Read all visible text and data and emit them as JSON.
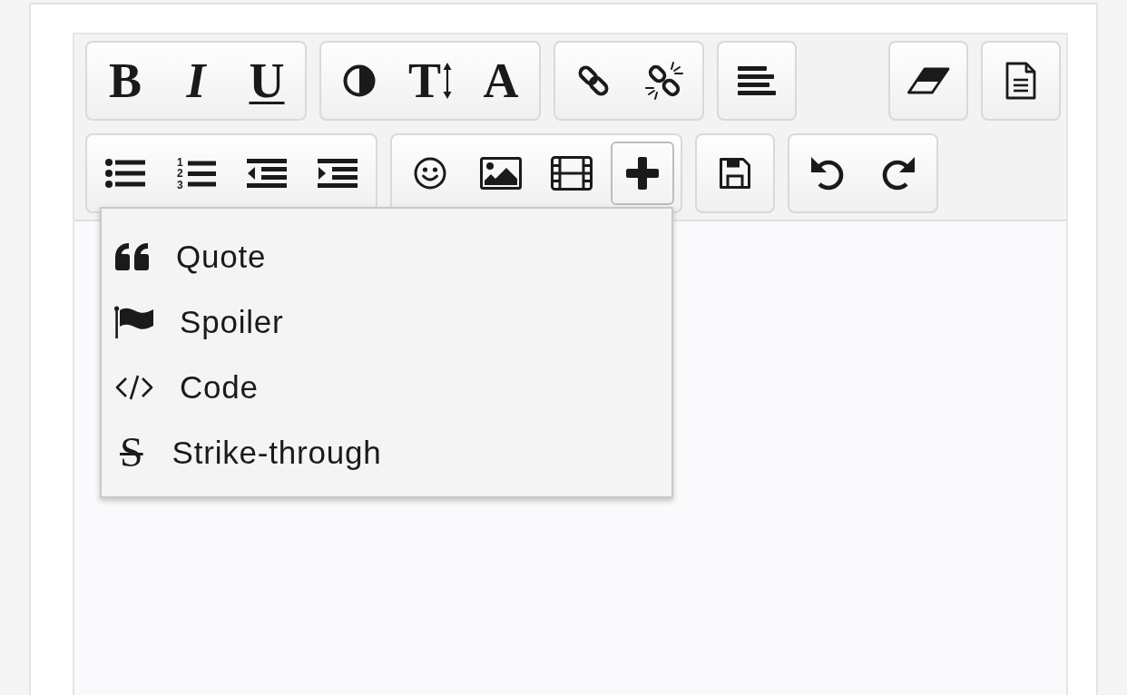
{
  "toolbar": {
    "rows": [
      {
        "groups": [
          {
            "buttons": [
              {
                "kind": "bold",
                "glyph": "B",
                "active": false
              },
              {
                "kind": "italic",
                "glyph": "I",
                "active": false
              },
              {
                "kind": "underline",
                "glyph": "U",
                "active": false
              }
            ]
          },
          {
            "buttons": [
              {
                "kind": "color",
                "active": false
              },
              {
                "kind": "font_size",
                "glyph": "T",
                "active": false
              },
              {
                "kind": "font",
                "glyph": "A",
                "active": false
              }
            ]
          },
          {
            "buttons": [
              {
                "kind": "link",
                "active": false
              },
              {
                "kind": "unlink",
                "active": false
              }
            ]
          },
          {
            "buttons": [
              {
                "kind": "align",
                "active": false
              }
            ]
          }
        ],
        "end_groups": [
          {
            "buttons": [
              {
                "kind": "clear_format",
                "active": false
              }
            ]
          },
          {
            "buttons": [
              {
                "kind": "source",
                "active": false
              }
            ]
          }
        ]
      },
      {
        "groups": [
          {
            "buttons": [
              {
                "kind": "bullet_list",
                "active": false
              },
              {
                "kind": "numbered_list",
                "marks": [
                  "1",
                  "2",
                  "3"
                ],
                "active": false
              },
              {
                "kind": "outdent",
                "active": false
              },
              {
                "kind": "indent",
                "active": false
              }
            ]
          },
          {
            "buttons": [
              {
                "kind": "emoji",
                "active": false
              },
              {
                "kind": "image",
                "active": false
              },
              {
                "kind": "video",
                "active": false
              },
              {
                "kind": "more",
                "active": true,
                "menu": [
                  {
                    "kind": "quote",
                    "label": "Quote"
                  },
                  {
                    "kind": "spoiler",
                    "label": "Spoiler"
                  },
                  {
                    "kind": "code",
                    "label": "Code"
                  },
                  {
                    "kind": "strikethrough",
                    "glyph": "S",
                    "label": "Strike-through"
                  }
                ]
              }
            ]
          },
          {
            "buttons": [
              {
                "kind": "save",
                "active": false
              }
            ]
          },
          {
            "buttons": [
              {
                "kind": "undo",
                "active": false
              },
              {
                "kind": "redo",
                "active": false
              }
            ]
          }
        ]
      }
    ]
  }
}
